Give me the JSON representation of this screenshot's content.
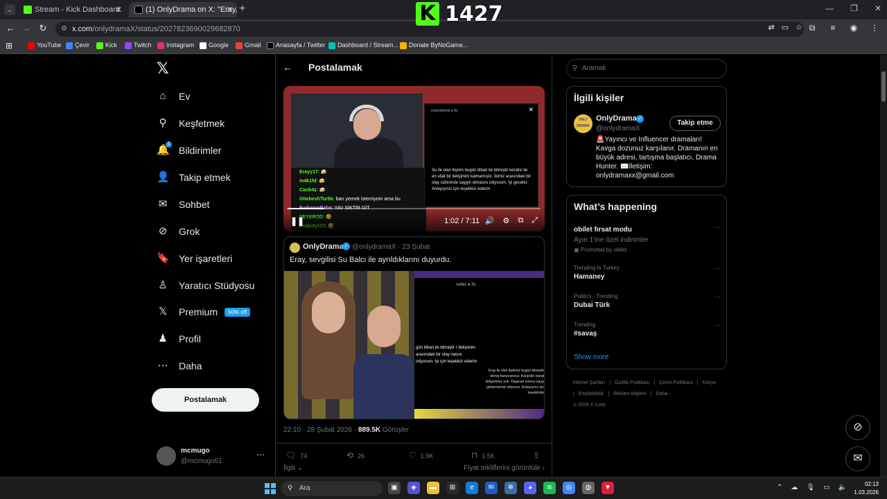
{
  "browser": {
    "tabs": [
      {
        "title": "Stream - Kick Dashboard",
        "favicon_color": "#53fc18"
      },
      {
        "title": "(1) OnlyDrama on X: \"Eray, S",
        "favicon_color": "#000000"
      }
    ],
    "url": {
      "host": "x.com",
      "path": "/onlydramaX/status/2027823690029682870"
    },
    "bookmarks": [
      {
        "label": "YouTube",
        "color": "#ff0000"
      },
      {
        "label": "Çevir",
        "color": "#4285f4"
      },
      {
        "label": "Kick",
        "color": "#53fc18"
      },
      {
        "label": "Twitch",
        "color": "#9146ff"
      },
      {
        "label": "Instagram",
        "color": "#e1306c"
      },
      {
        "label": "Google",
        "color": "#ffffff"
      },
      {
        "label": "Gmail",
        "color": "#ea4335"
      },
      {
        "label": "Anasayfa / Twitter",
        "color": "#000000"
      },
      {
        "label": "Dashboard / Stream...",
        "color": "#00c4b3"
      },
      {
        "label": "Donate ByNoGame...",
        "color": "#f4b400"
      }
    ]
  },
  "overlay": {
    "kick_letter": "K",
    "viewer_count": "1427"
  },
  "sidebar": {
    "items": [
      {
        "label": "Ev",
        "icon": "home-icon",
        "glyph": "⌂"
      },
      {
        "label": "Keşfetmek",
        "icon": "search-icon",
        "glyph": "⚲"
      },
      {
        "label": "Bildirimler",
        "icon": "bell-icon",
        "glyph": "🔔"
      },
      {
        "label": "Takip etmek",
        "icon": "follow-icon",
        "glyph": "👤"
      },
      {
        "label": "Sohbet",
        "icon": "mail-icon",
        "glyph": "✉"
      },
      {
        "label": "Grok",
        "icon": "grok-icon",
        "glyph": "⊘"
      },
      {
        "label": "Yer işaretleri",
        "icon": "bookmark-icon",
        "glyph": "🔖"
      },
      {
        "label": "Yaratıcı Stüdyosu",
        "icon": "creator-studio-icon",
        "glyph": "♙"
      },
      {
        "label": "Premium",
        "icon": "x-premium-icon",
        "glyph": "𝕏"
      },
      {
        "label": "Profil",
        "icon": "profile-icon",
        "glyph": "♟"
      },
      {
        "label": "Daha",
        "icon": "more-icon",
        "glyph": "⋯"
      }
    ],
    "notification_count": "1",
    "premium_badge": "50% off",
    "post_button": "Postalamak",
    "account": {
      "name": "mcmugo",
      "handle": "@mcmugo61"
    }
  },
  "main": {
    "title": "Postalamak",
    "video": {
      "time": "1:02 / 7:11",
      "progress": 0.144,
      "chat": [
        {
          "user": "Erayy17",
          "msg": ": 🍻",
          "color": "#53fc18"
        },
        {
          "user": "m4k1fd",
          "msg": ": 🍻",
          "color": "#53fc18"
        },
        {
          "user": "Canb4z",
          "msg": ": 🍻",
          "color": "#53fc18"
        },
        {
          "user": "GhebeshTurtle",
          "msg": ": ban yemek istemiyom ama bu",
          "color": "#53fc18"
        },
        {
          "user": "FurkanınBaba",
          "msg": ": YAV SİKTİR GİT",
          "color": "#c4a1ff"
        },
        {
          "user": "SEYEROD",
          "msg": ": 🤣",
          "color": "#53fc18"
        },
        {
          "user": "oraputy123",
          "msg": ": 🤣",
          "color": "#53fc18"
        }
      ],
      "story_user": "erayozkenar ● 9s",
      "story_text": "Su ile olan ilişkim bugün itibari ile bitmiştir kendisi ile en ufak bir iletişimim kalmamıştır. İkimiz arasındaki bir olay sizlerinde saygılı olmasını istiyorum. İyi geceler. Anlayışınız için teşekkür ederim"
    },
    "quote": {
      "name": "OnlyDrama",
      "handle": "@onlydramaX · 23 Şubat",
      "text": "Eray, sevgilisi Su Balcı ile ayrıldıklarını duyurdu.",
      "img2_header": "subici ● 3s",
      "img2_text_left": "gün itibari ile bitmiştir r iletişimim arasındaki bir olay nasını istiyorum. İyi için teşekkür ederim",
      "img2_text_right": "Eray ile olan ilişkimiz bugün itibariyle bitmiş bulunuyoruz. Karşılıklı olarak iletişimimiz yok. Yaşanan sürece saygı göstermenizi istiyoruz. Anlayışınız için teşekkürler"
    },
    "meta": {
      "time": "22:10 · 28 Şubat 2026 · ",
      "views": "889.5K",
      "views_label": " Görüşler"
    },
    "actions": {
      "replies": "74",
      "reposts": "26",
      "likes": "1.9K",
      "bookmarks": "1.5K"
    },
    "related_label": "İlgili",
    "offers_label": "Fiyat tekliflerini görüntüle"
  },
  "right": {
    "search_placeholder": "Aramak",
    "relevant": {
      "title": "İlgili kişiler",
      "avatar_text": "ONLY DRAMA",
      "name": "OnlyDrama",
      "handle": "@onlydramaX",
      "follow": "Takip etme",
      "bio": "🚨Yayıncı ve Influencer dramaları! Kavga dozunuz karşılanır. Dramanın en büyük adresi, tartışma başlatıcı, Drama Hunter. ✉️İletişim: onlydramaxx@gmail.com"
    },
    "happening": {
      "title": "What’s happening",
      "trends": [
        {
          "category": "",
          "title": "obilet fırsat modu",
          "sub": "Ayın 1'ine özel indirimler",
          "promo": "Promoted by obilet"
        },
        {
          "category": "Trending in Turkey",
          "title": "Hamaney",
          "sub": "",
          "promo": ""
        },
        {
          "category": "Politics · Trending",
          "title": "Dubai Türk",
          "sub": "",
          "promo": ""
        },
        {
          "category": "Trending",
          "title": "#savaş",
          "sub": "",
          "promo": ""
        }
      ],
      "show_more": "Show more"
    },
    "footer": [
      "Hizmet Şartları",
      "|",
      "Gizlilik Politikası",
      "|",
      "Çerez Politikası",
      "|",
      "Künye",
      "|",
      "Erişilebilirlik",
      "|",
      "Reklam bilgileri",
      "|",
      "Daha ···",
      "© 2026 X Corp."
    ]
  },
  "taskbar": {
    "search": "Ara",
    "time": "02:13",
    "date": "1.03.2026"
  }
}
